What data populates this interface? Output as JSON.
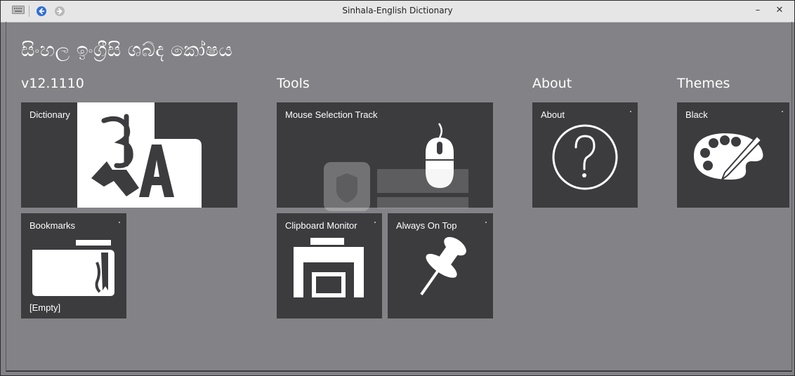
{
  "window": {
    "title": "Sinhala-English Dictionary",
    "minimize_label": "–",
    "close_label": "✕"
  },
  "app": {
    "heading": "සිංහල ඉංග්‍රීසි ශබ්ද කෝෂය"
  },
  "groups": {
    "version": "v12.1110",
    "tools": "Tools",
    "about": "About",
    "themes": "Themes"
  },
  "tiles": {
    "dictionary": {
      "label": "Dictionary",
      "icon": "translate-icon"
    },
    "bookmarks": {
      "label": "Bookmarks",
      "sub": "[Empty]",
      "icon": "folder-icon"
    },
    "mouse_selection": {
      "label": "Mouse Selection Track",
      "icon": "mouse-icon"
    },
    "clipboard": {
      "label": "Clipboard Monitor",
      "icon": "printer-icon"
    },
    "always_on_top": {
      "label": "Always On Top",
      "icon": "pushpin-icon"
    },
    "about": {
      "label": "About",
      "icon": "question-icon"
    },
    "black": {
      "label": "Black",
      "icon": "palette-icon"
    }
  },
  "colors": {
    "background": "#838286",
    "tile": "#3c3b3e",
    "titlebar": "#e6e6e6"
  }
}
